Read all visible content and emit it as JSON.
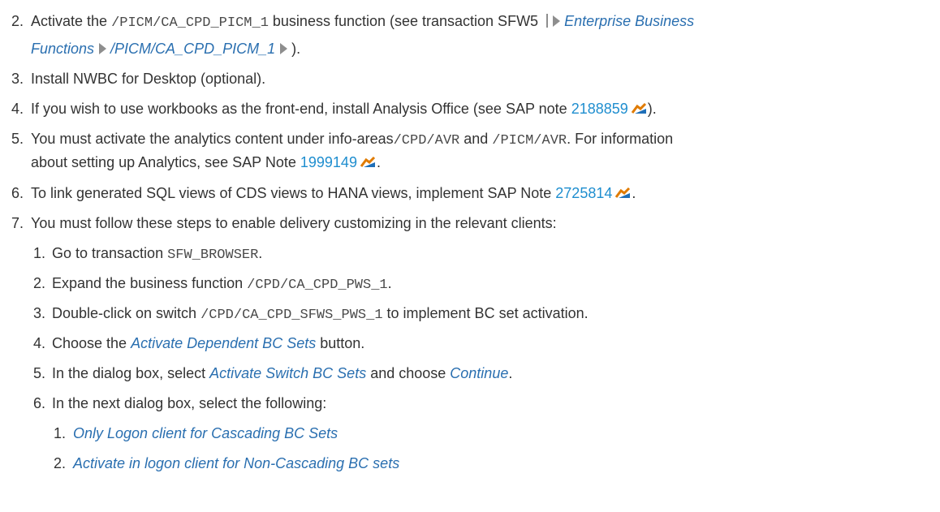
{
  "items": {
    "n2": "2.",
    "s2a": "Activate the ",
    "s2b": "/PICM/CA_CPD_PICM_1",
    "s2c": " business function (see transaction SFW5 ",
    "s2d": "Enterprise Business",
    "s2e": "Functions",
    "s2f": "/PICM/CA_CPD_PICM_1",
    "s2g": ").",
    "n3": "3.",
    "s3": "Install NWBC for Desktop (optional).",
    "n4": "4.",
    "s4a": "If you wish to use workbooks as the front-end, install Analysis Office (see SAP note ",
    "s4b": "2188859",
    "s4c": ").",
    "n5": "5.",
    "s5a": "You must activate the analytics content under info-areas",
    "s5b": "/CPD/AVR",
    "s5c": " and ",
    "s5d": "/PICM/AVR",
    "s5e": ". For information",
    "s5f": "about setting up Analytics, see SAP Note ",
    "s5g": "1999149",
    "s5h": ".",
    "n6": "6.",
    "s6a": "To link generated SQL views of CDS views to HANA views, implement SAP Note ",
    "s6b": "2725814",
    "s6c": ".",
    "n7": "7.",
    "s7": "You must follow these steps to enable delivery customizing in the relevant clients:",
    "m1": "1.",
    "t1a": "Go to transaction ",
    "t1b": "SFW_BROWSER",
    "t1c": ".",
    "m2": "2.",
    "t2a": "Expand the business function ",
    "t2b": "/CPD/CA_CPD_PWS_1",
    "t2c": ".",
    "m3": "3.",
    "t3a": "Double-click on switch ",
    "t3b": "/CPD/CA_CPD_SFWS_PWS_1",
    "t3c": " to implement BC set activation.",
    "m4": "4.",
    "t4a": "Choose the ",
    "t4b": "Activate Dependent BC Sets",
    "t4c": " button.",
    "m5": "5.",
    "t5a": "In the dialog box, select ",
    "t5b": "Activate Switch BC Sets",
    "t5c": " and choose ",
    "t5d": "Continue",
    "t5e": ".",
    "m6": "6.",
    "t6": "In the next dialog box, select the following:",
    "k1": "1.",
    "u1": "Only Logon client for Cascading BC Sets",
    "k2": "2.",
    "u2": "Activate in logon client for Non-Cascading BC sets"
  },
  "icons": {
    "path_arrow": "nav-arrow-icon",
    "external": "external-link-icon"
  },
  "colors": {
    "text": "#333333",
    "link": "#1f8ecf",
    "ui_term": "#2a6fb0",
    "code": "#4a4a4a"
  }
}
